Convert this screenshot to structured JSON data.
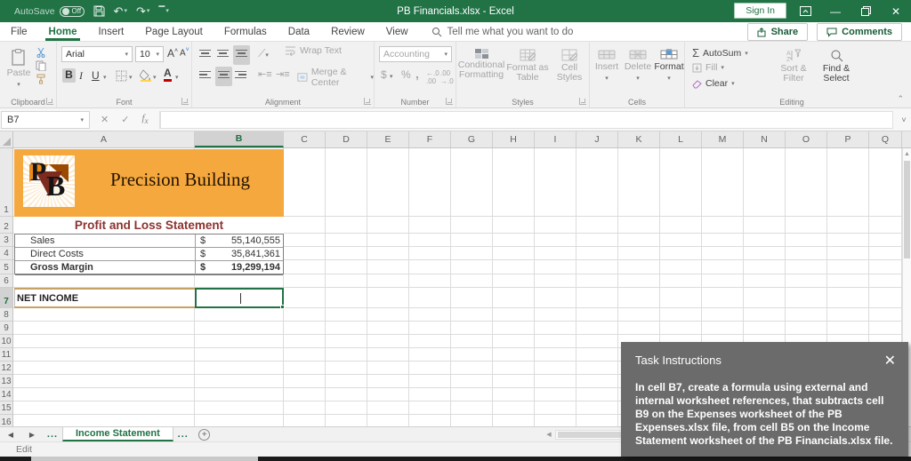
{
  "titlebar": {
    "autosave_label": "AutoSave",
    "autosave_state": "Off",
    "title": "PB Financials.xlsx - Excel",
    "sign_in": "Sign In"
  },
  "menu": {
    "tabs": [
      "File",
      "Home",
      "Insert",
      "Page Layout",
      "Formulas",
      "Data",
      "Review",
      "View"
    ],
    "active_tab": "Home",
    "tell_me": "Tell me what you want to do",
    "share": "Share",
    "comments": "Comments"
  },
  "ribbon": {
    "paste": "Paste",
    "font_name": "Arial",
    "font_size": "10",
    "wrap_text": "Wrap Text",
    "merge_center": "Merge & Center",
    "number_format": "Accounting",
    "conditional_formatting": "Conditional Formatting",
    "format_as_table": "Format as Table",
    "cell_styles": "Cell Styles",
    "insert": "Insert",
    "delete": "Delete",
    "format": "Format",
    "autosum": "AutoSum",
    "fill": "Fill",
    "clear": "Clear",
    "sort_filter": "Sort & Filter",
    "find_select": "Find & Select",
    "groups": {
      "clipboard": "Clipboard",
      "font": "Font",
      "alignment": "Alignment",
      "number": "Number",
      "styles": "Styles",
      "cells": "Cells",
      "editing": "Editing"
    }
  },
  "formula_bar": {
    "name_box": "B7",
    "formula": ""
  },
  "sheet": {
    "columns": [
      "A",
      "B",
      "C",
      "D",
      "E",
      "F",
      "G",
      "H",
      "I",
      "J",
      "K",
      "L",
      "M",
      "N",
      "O",
      "P",
      "Q"
    ],
    "rows": [
      "1",
      "2",
      "3",
      "4",
      "5",
      "6",
      "7",
      "8",
      "9",
      "10",
      "11",
      "12",
      "13",
      "14",
      "15",
      "16"
    ],
    "selected_column": "B",
    "selected_row": "7"
  },
  "content": {
    "logo_p": "P",
    "logo_b": "B",
    "company": "Precision Building",
    "statement_title": "Profit and Loss Statement",
    "rows": [
      {
        "label": "Sales",
        "currency": "$",
        "value": "55,140,555"
      },
      {
        "label": "Direct Costs",
        "currency": "$",
        "value": "35,841,361"
      },
      {
        "label": "Gross Margin",
        "currency": "$",
        "value": "19,299,194"
      }
    ],
    "net_income_label": "NET INCOME"
  },
  "tabs_bar": {
    "sheet_tab": "Income Statement",
    "ellipsis": "...",
    "status": "Edit"
  },
  "task_panel": {
    "title": "Task Instructions",
    "body": "In cell B7, create a formula using external and internal worksheet references, that subtracts cell B9 on the Expenses worksheet of the PB Expenses.xlsx file, from cell B5 on the Income Statement worksheet of the PB Financials.xlsx file."
  },
  "colors": {
    "excel_green": "#217346",
    "banner_orange": "#f5a83d",
    "title_maroon": "#8b3330",
    "panel_gray": "#6b6b6b"
  }
}
